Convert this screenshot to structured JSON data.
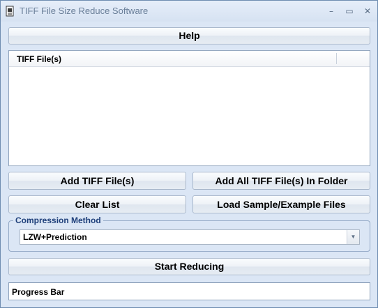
{
  "window": {
    "title": "TIFF File Size Reduce Software",
    "controls": {
      "minimize": "–",
      "maximize": "▭",
      "close": "✕"
    }
  },
  "help_button": {
    "label": "Help"
  },
  "file_list": {
    "column_header": "TIFF File(s)",
    "items": []
  },
  "buttons": {
    "add_files": "Add TIFF File(s)",
    "add_folder": "Add All TIFF File(s) In Folder",
    "clear_list": "Clear List",
    "load_samples": "Load Sample/Example Files",
    "start": "Start Reducing"
  },
  "compression": {
    "group_label": "Compression Method",
    "selected": "LZW+Prediction"
  },
  "progress": {
    "label": "Progress Bar",
    "value_percent": 0
  },
  "icons": {
    "app": "tiff-file-icon",
    "dropdown": "chevron-down-icon"
  },
  "colors": {
    "window_bg": "#dbe6f5",
    "group_label": "#1e3f7a",
    "border": "#8fa3bd"
  }
}
